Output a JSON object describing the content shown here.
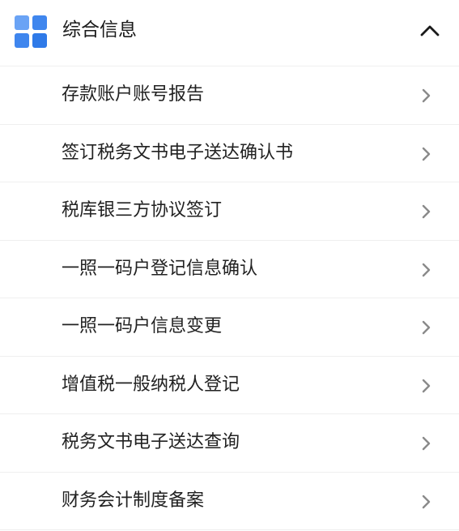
{
  "section": {
    "title": "综合信息",
    "expanded": true,
    "icon": "grid-icon",
    "toggle_icon": "chevron-up-icon",
    "accent_color": "#3f86ee"
  },
  "items": [
    {
      "label": "存款账户账号报告",
      "icon": "chevron-right-icon"
    },
    {
      "label": "签订税务文书电子送达确认书",
      "icon": "chevron-right-icon"
    },
    {
      "label": "税库银三方协议签订",
      "icon": "chevron-right-icon"
    },
    {
      "label": "一照一码户登记信息确认",
      "icon": "chevron-right-icon"
    },
    {
      "label": "一照一码户信息变更",
      "icon": "chevron-right-icon"
    },
    {
      "label": "增值税一般纳税人登记",
      "icon": "chevron-right-icon"
    },
    {
      "label": "税务文书电子送达查询",
      "icon": "chevron-right-icon"
    },
    {
      "label": "财务会计制度备案",
      "icon": "chevron-right-icon"
    }
  ]
}
